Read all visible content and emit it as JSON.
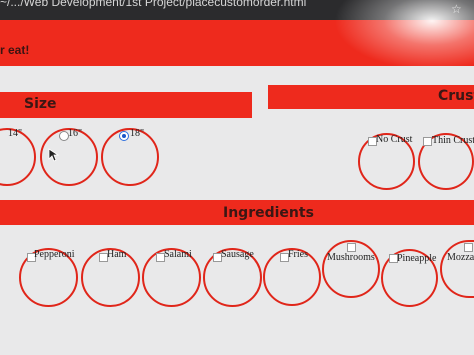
{
  "browser": {
    "url_text": "~/.../Web Development/1st Project/placecustomorder.html"
  },
  "header": {
    "tagline": "r eat!"
  },
  "sections": {
    "size_title": "Size",
    "crust_title": "Crust",
    "ingredients_title": "Ingredients"
  },
  "size_options": [
    {
      "label": "14\"",
      "selected": false
    },
    {
      "label": "16\"",
      "selected": false
    },
    {
      "label": "18\"",
      "selected": true
    }
  ],
  "crust_options": [
    {
      "label": "No Crust",
      "checked": false
    },
    {
      "label": "Thin Crust",
      "checked": false
    }
  ],
  "ingredients": [
    {
      "label": "Pepperoni",
      "checked": false
    },
    {
      "label": "Ham",
      "checked": false
    },
    {
      "label": "Salami",
      "checked": false
    },
    {
      "label": "Sausage",
      "checked": false
    },
    {
      "label": "Fries",
      "checked": false
    },
    {
      "label": "Mushrooms",
      "checked": false
    },
    {
      "label": "Pineapple",
      "checked": false
    },
    {
      "label": "Mozzarella",
      "checked": false
    }
  ],
  "colors": {
    "accent": "#ee2a1d",
    "ring": "#e0261a",
    "page_bg": "#e9e9ea",
    "heading_text": "#3b1714"
  },
  "icons": [
    "star-icon",
    "mouse-cursor-icon"
  ]
}
